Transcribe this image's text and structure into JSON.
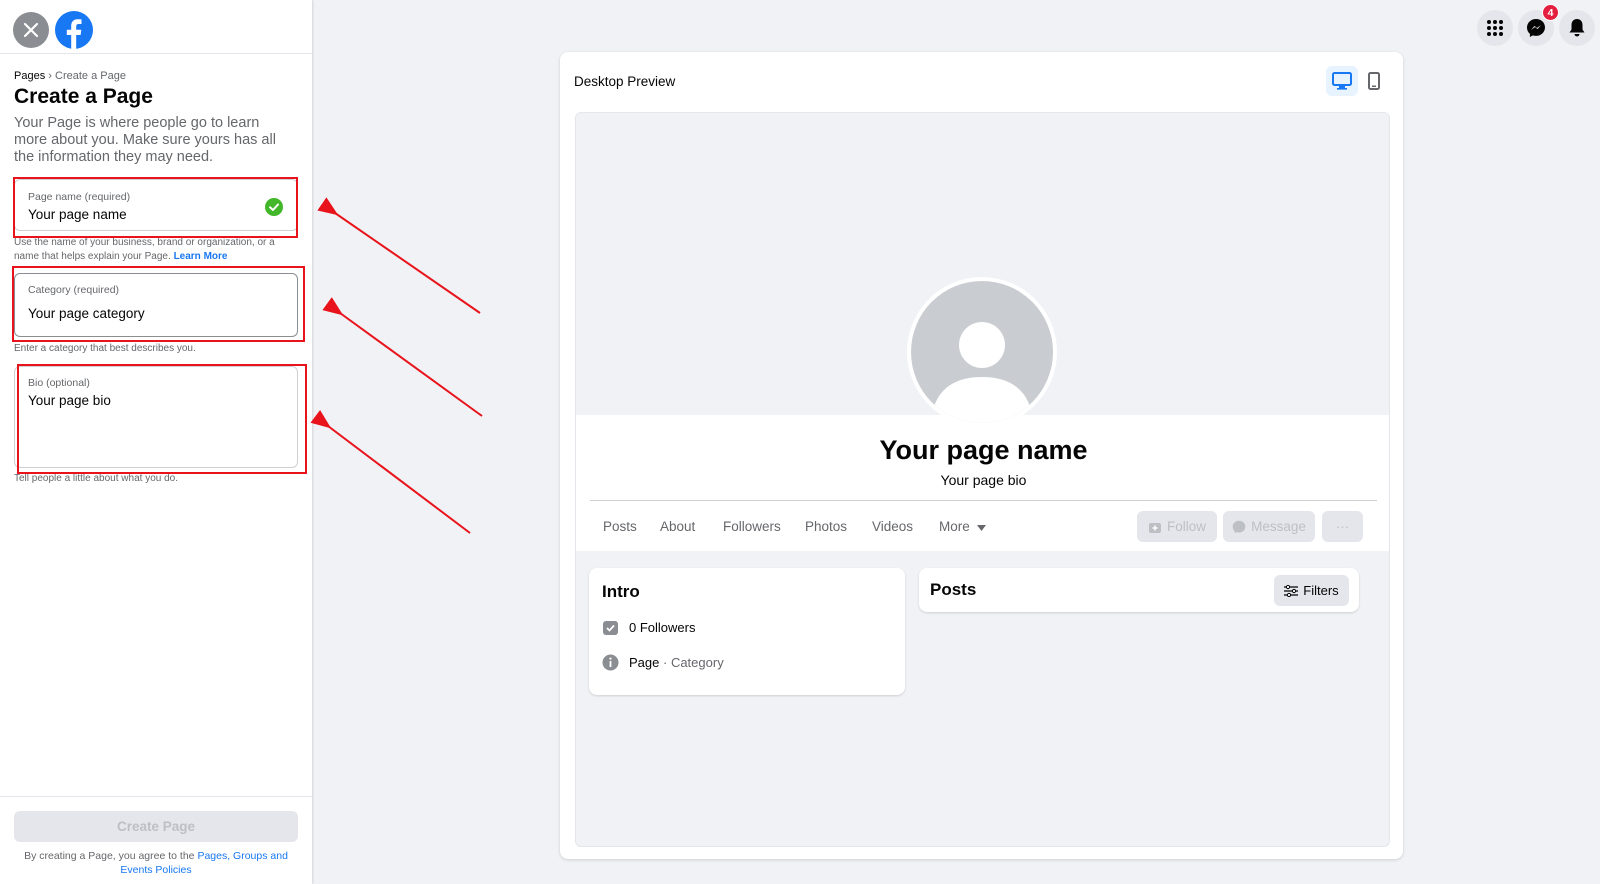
{
  "sidebar": {
    "breadcrumb_root": "Pages",
    "breadcrumb_sep": "›",
    "breadcrumb_current": "Create a Page",
    "title": "Create a Page",
    "description": "Your Page is where people go to learn more about you. Make sure yours has all the information they may need.",
    "page_name": {
      "label": "Page name (required)",
      "value": "Your page name",
      "hint": "Use the name of your business, brand or organization, or a name that helps explain your Page.",
      "hint_link": "Learn More"
    },
    "category": {
      "label": "Category (required)",
      "value": "Your page category",
      "hint": "Enter a category that best describes you."
    },
    "bio": {
      "label": "Bio (optional)",
      "value": "Your page bio",
      "hint": "Tell people a little about what you do."
    },
    "create_button": "Create Page",
    "terms_prefix": "By creating a Page, you agree to the",
    "terms_link": "Pages, Groups and Events Policies"
  },
  "topbar": {
    "messenger_badge": "4"
  },
  "preview": {
    "title": "Desktop Preview",
    "page_name": "Your page name",
    "page_bio": "Your page bio",
    "tabs": [
      "Posts",
      "About",
      "Followers",
      "Photos",
      "Videos",
      "More"
    ],
    "follow_button": "Follow",
    "message_button": "Message",
    "more_button": "···",
    "intro_title": "Intro",
    "followers": "0 Followers",
    "page_label": "Page",
    "page_category": "· Category",
    "posts_title": "Posts",
    "filters_button": "Filters"
  },
  "colors": {
    "brand_blue": "#1877f2",
    "annotation_red": "#e8131b",
    "success_green": "#42b72a"
  }
}
